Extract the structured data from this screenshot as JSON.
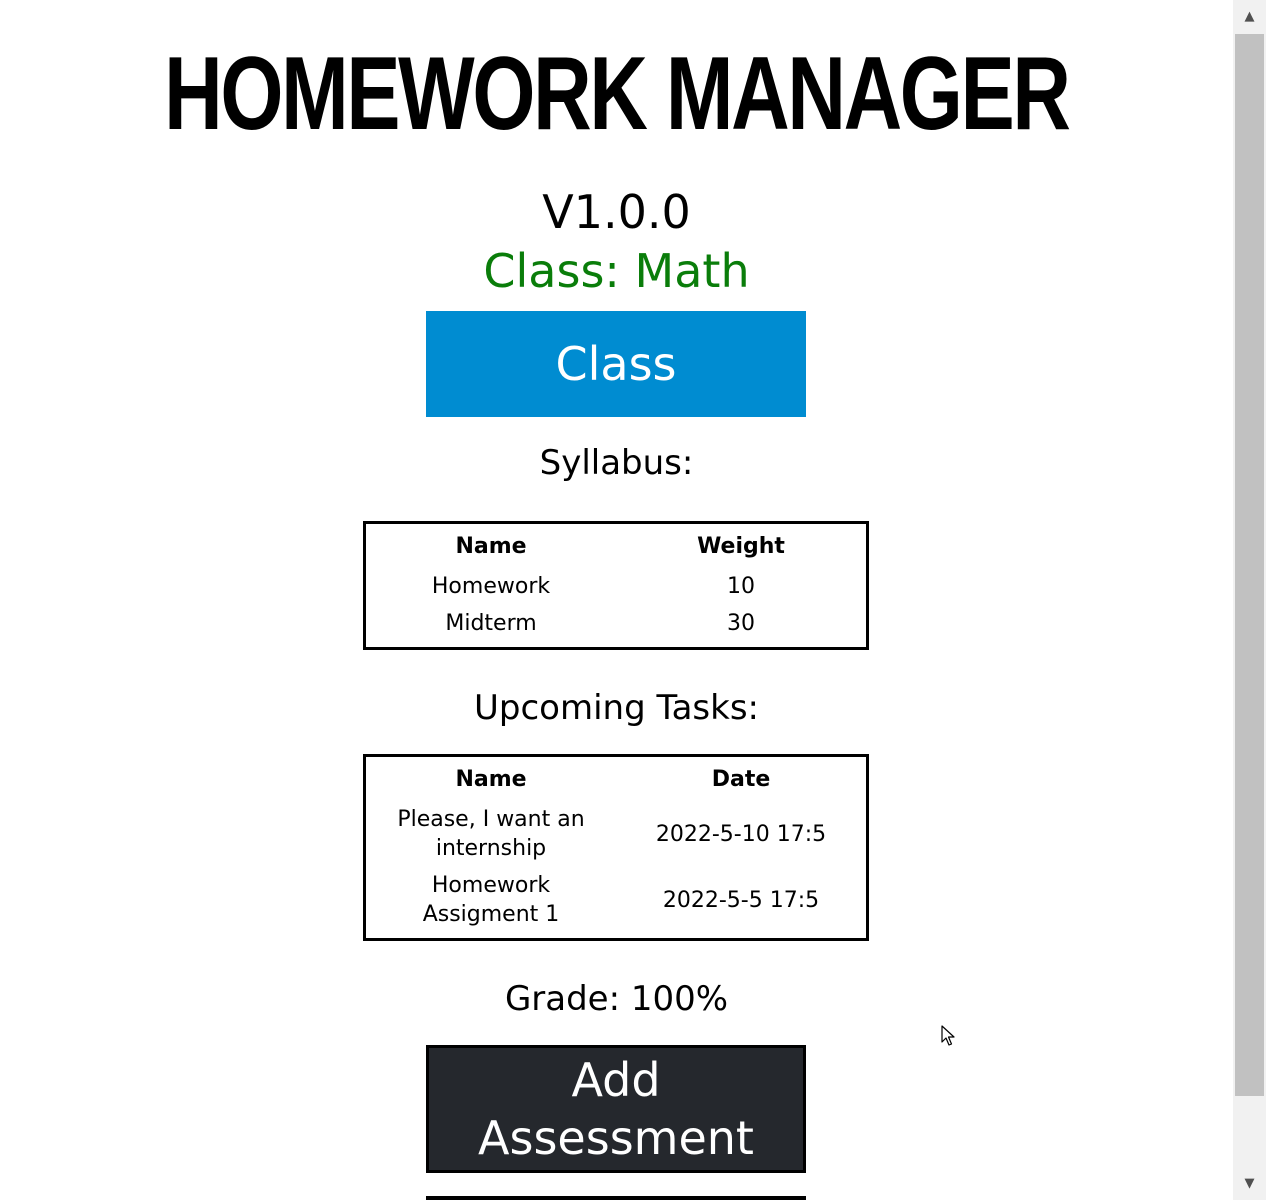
{
  "header": {
    "title": "HOMEWORK MANAGER",
    "version": "V1.0.0",
    "class_label": "Class: Math"
  },
  "class_button": {
    "label": "Class"
  },
  "syllabus": {
    "heading": "Syllabus:",
    "columns": [
      "Name",
      "Weight"
    ],
    "rows": [
      [
        "Homework",
        "10"
      ],
      [
        "Midterm",
        "30"
      ]
    ]
  },
  "tasks": {
    "heading": "Upcoming Tasks:",
    "columns": [
      "Name",
      "Date"
    ],
    "rows": [
      [
        "Please, I want an internship",
        "2022-5-10 17:5"
      ],
      [
        "Homework Assigment 1",
        "2022-5-5 17:5"
      ]
    ]
  },
  "grade": {
    "text": "Grade: 100%"
  },
  "add_button": {
    "label": "Add Assessment"
  },
  "colors": {
    "class_label": "#0a7d0a",
    "class_button": "#008cd1",
    "add_button": "#25282d"
  },
  "icons": {
    "scroll_up": "scroll-up-arrow-icon",
    "scroll_down": "scroll-down-arrow-icon",
    "cursor": "mouse-pointer-icon"
  }
}
